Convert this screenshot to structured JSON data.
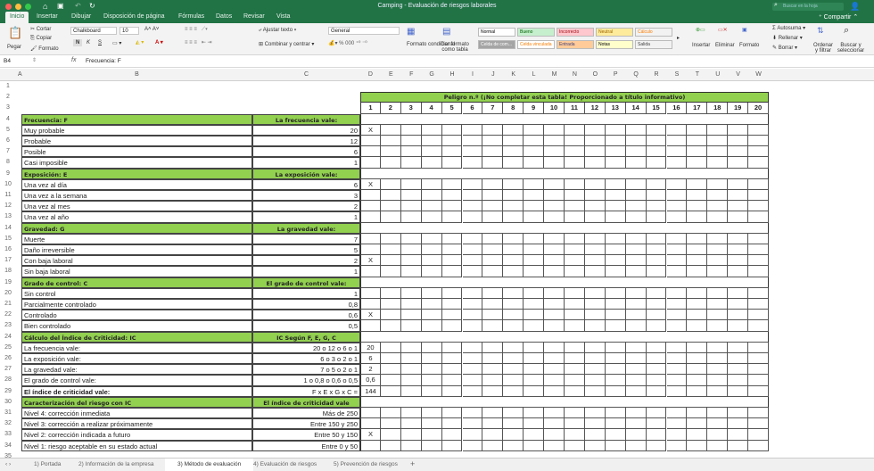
{
  "window": {
    "title": "Camping - Evaluación de riesgos laborales",
    "search_placeholder": "Buscar en la hoja",
    "share": "Compartir"
  },
  "menu_tabs": [
    "Inicio",
    "Insertar",
    "Dibujar",
    "Disposición de página",
    "Fórmulas",
    "Datos",
    "Revisar",
    "Vista"
  ],
  "ribbon": {
    "paste": "Pegar",
    "cut": "Cortar",
    "copy": "Copiar",
    "format_painter": "Formato",
    "font": "Chalkboard",
    "font_size": "10",
    "bold": "N",
    "italic": "K",
    "underline": "S",
    "wrap": "Ajustar texto",
    "merge": "Combinar y centrar",
    "number_format": "General",
    "cond_format": "Formato condicional",
    "table_format": "Dar formato como tabla",
    "styles": [
      {
        "label": "Normal",
        "bg": "#ffffff",
        "fg": "#000000"
      },
      {
        "label": "Bueno",
        "bg": "#c6efce",
        "fg": "#006100"
      },
      {
        "label": "Incorrecto",
        "bg": "#ffc7ce",
        "fg": "#9c0006"
      },
      {
        "label": "Neutral",
        "bg": "#ffeb9c",
        "fg": "#9c6500"
      },
      {
        "label": "Cálculo",
        "bg": "#f2f2f2",
        "fg": "#fa7d00"
      },
      {
        "label": "Celda de com...",
        "bg": "#a5a5a5",
        "fg": "#ffffff"
      },
      {
        "label": "Celda vinculada",
        "bg": "#ffffff",
        "fg": "#fa7d00"
      },
      {
        "label": "Entrada",
        "bg": "#ffcc99",
        "fg": "#3f3f76"
      },
      {
        "label": "Notas",
        "bg": "#ffffcc",
        "fg": "#000000"
      },
      {
        "label": "Salida",
        "bg": "#f2f2f2",
        "fg": "#3f3f3f"
      }
    ],
    "insert": "Insertar",
    "delete": "Eliminar",
    "format": "Formato",
    "autosum": "Autosuma",
    "fill": "Rellenar",
    "clear": "Borrar",
    "sort": "Ordenar y filtrar",
    "find": "Buscar y seleccionar"
  },
  "formula_bar": {
    "cell_ref": "B4",
    "fx": "fx",
    "formula": "Frecuencia: F"
  },
  "columns": [
    "A",
    "B",
    "C",
    "D",
    "E",
    "F",
    "G",
    "H",
    "I",
    "J",
    "K",
    "L",
    "M",
    "N",
    "O",
    "P",
    "Q",
    "R",
    "S",
    "T",
    "U",
    "V",
    "W"
  ],
  "peligro_header": "Peligro n.º  (¡No completar esta tabla! Proporcionado a título informativo)",
  "peligro_numbers": [
    "1",
    "2",
    "3",
    "4",
    "5",
    "6",
    "7",
    "8",
    "9",
    "10",
    "11",
    "12",
    "13",
    "14",
    "15",
    "16",
    "17",
    "18",
    "19",
    "20"
  ],
  "rows": [
    {
      "n": "4",
      "b": "Frecuencia: F",
      "c": "La frecuencia vale:",
      "header": true
    },
    {
      "n": "5",
      "b": "Muy probable",
      "c": "20",
      "d": "X"
    },
    {
      "n": "6",
      "b": "Probable",
      "c": "12"
    },
    {
      "n": "7",
      "b": "Posible",
      "c": "6"
    },
    {
      "n": "8",
      "b": "Casi imposible",
      "c": "1"
    },
    {
      "n": "9",
      "b": "Exposición: E",
      "c": "La exposición vale:",
      "header": true
    },
    {
      "n": "10",
      "b": "Una vez al día",
      "c": "6",
      "d": "X"
    },
    {
      "n": "11",
      "b": "Una vez a la semana",
      "c": "3"
    },
    {
      "n": "12",
      "b": "Una vez al mes",
      "c": "2"
    },
    {
      "n": "13",
      "b": "Una vez al año",
      "c": "1"
    },
    {
      "n": "14",
      "b": "Gravedad: G",
      "c": "La gravedad vale:",
      "header": true
    },
    {
      "n": "15",
      "b": "Muerte",
      "c": "7"
    },
    {
      "n": "16",
      "b": "Daño irreversible",
      "c": "5"
    },
    {
      "n": "17",
      "b": "Con baja laboral",
      "c": "2",
      "d": "X"
    },
    {
      "n": "18",
      "b": "Sin baja laboral",
      "c": "1"
    },
    {
      "n": "19",
      "b": "Grado de control: C",
      "c": "El grado de control vale:",
      "header": true
    },
    {
      "n": "20",
      "b": "Sin control",
      "c": "1"
    },
    {
      "n": "21",
      "b": "Parcialmente controlado",
      "c": "0,8"
    },
    {
      "n": "22",
      "b": "Controlado",
      "c": "0,6",
      "d": "X"
    },
    {
      "n": "23",
      "b": "Bien controlado",
      "c": "0,5"
    },
    {
      "n": "24",
      "b": "Cálculo del Índice de Criticidad: IC",
      "c": "IC Según F, E, G, C",
      "header": true
    },
    {
      "n": "25",
      "b": "La frecuencia vale:",
      "c": "20 o 12 o 6 o 1",
      "d": "20"
    },
    {
      "n": "26",
      "b": "La exposición vale:",
      "c": "6 o 3 o 2 o 1",
      "d": "6"
    },
    {
      "n": "27",
      "b": "La gravedad vale:",
      "c": "7 o 5 o 2 o 1",
      "d": "2"
    },
    {
      "n": "28",
      "b": "El grado de control vale:",
      "c": "1 o 0,8 o 0,6 o 0,5",
      "d": "0,6"
    },
    {
      "n": "29",
      "b": "El índice de criticidad vale:",
      "c": "F x E x G x C =",
      "d": "144",
      "bold": true
    },
    {
      "n": "30",
      "b": "Caracterización del riesgo con IC",
      "c": "El índice de criticidad vale",
      "header": true
    },
    {
      "n": "31",
      "b": "Nivel 4: corrección inmediata",
      "c": "Más de 250"
    },
    {
      "n": "32",
      "b": "Nivel 3: corrección a realizar próximamente",
      "c": "Entre 150 y 250"
    },
    {
      "n": "33",
      "b": "Nivel 2: corrección indicada a futuro",
      "c": "Entre 50 y 150",
      "d": "X"
    },
    {
      "n": "34",
      "b": "Nivel 1: riesgo aceptable en su estado actual",
      "c": "Entre 0 y 50"
    }
  ],
  "sheet_tabs": [
    "1) Portada",
    "2) Información de la empresa",
    "3) Método de evaluación",
    "4) Evaluación de riesgos",
    "5) Prevención de riesgos"
  ],
  "active_sheet": "3) Método de evaluación",
  "add_sheet": "+",
  "colors": {
    "excel_green": "#217346",
    "header_fill": "#92d050"
  }
}
